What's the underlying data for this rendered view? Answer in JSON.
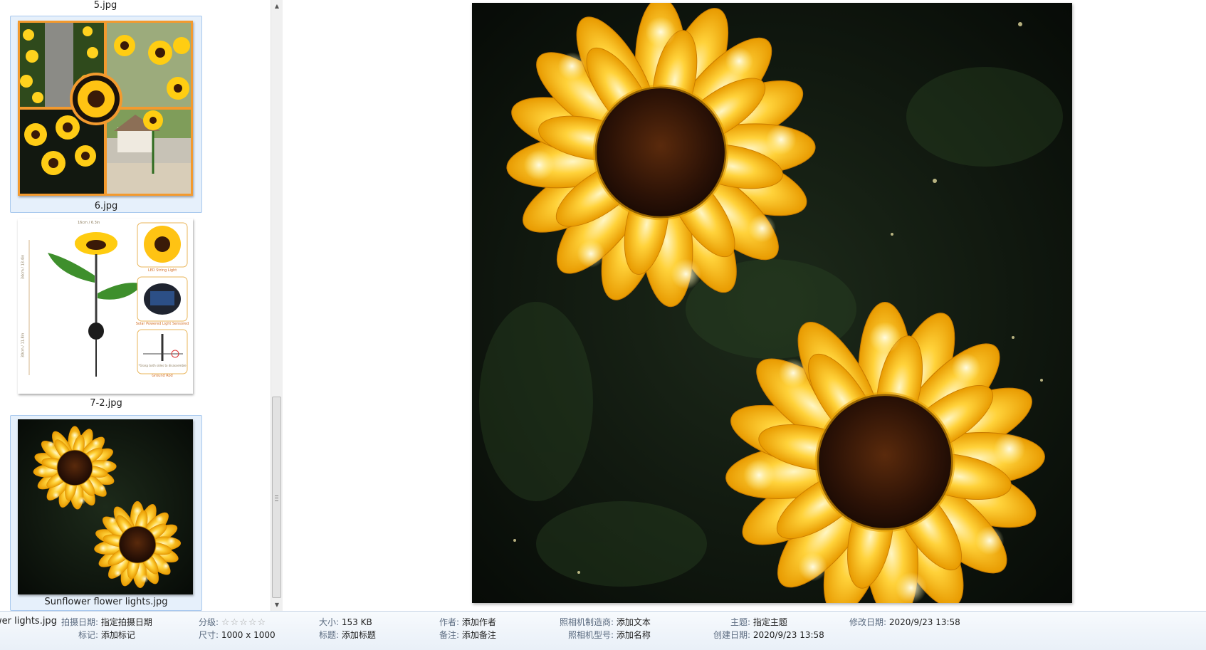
{
  "thumbnails": [
    {
      "caption": "5.jpg",
      "selected": false
    },
    {
      "caption": "6.jpg",
      "selected": true
    },
    {
      "caption": "7-2.jpg",
      "selected": false
    },
    {
      "caption": "Sunflower flower lights.jpg",
      "selected": true
    }
  ],
  "thumb_7_2_labels": {
    "width": "16cm / 6.3in",
    "upper_height": "34cm / 13.4in",
    "lower_height": "30cm / 11.8in",
    "led": "LED String Light",
    "solar": "Solar Powered Light Sensored",
    "rod_note": "*Grasp both sides to disassemble",
    "rod": "Ground Rod"
  },
  "scrollbar": {
    "up_icon": "▲",
    "down_icon": "▼"
  },
  "details": {
    "filename": "wer lights.jpg",
    "date_taken_label": "拍摄日期:",
    "date_taken_value": "指定拍摄日期",
    "tags_label": "标记:",
    "tags_value": "添加标记",
    "rating_label": "分级:",
    "rating_stars": "☆☆☆☆☆",
    "dimensions_label": "尺寸:",
    "dimensions_value": "1000 x 1000",
    "size_label": "大小:",
    "size_value": "153 KB",
    "title_label": "标题:",
    "title_value": "添加标题",
    "author_label": "作者:",
    "author_value": "添加作者",
    "comments_label": "备注:",
    "comments_value": "添加备注",
    "camera_maker_label": "照相机制造商:",
    "camera_maker_value": "添加文本",
    "camera_model_label": "照相机型号:",
    "camera_model_value": "添加名称",
    "subject_label": "主题:",
    "subject_value": "指定主题",
    "created_label": "创建日期:",
    "created_value": "2020/9/23 13:58",
    "modified_label": "修改日期:",
    "modified_value": "2020/9/23 13:58"
  },
  "colors": {
    "selection_bg": "#e6f0fb",
    "selection_border": "#a9c9ee",
    "details_bg": "#eef3f9",
    "night_bg": "#101810",
    "petal": "#ffc21a",
    "petal_glow": "#fff3b0",
    "seed_center": "#3a1a08"
  }
}
